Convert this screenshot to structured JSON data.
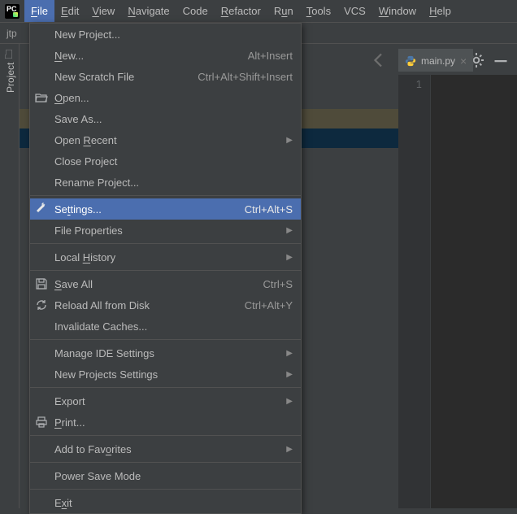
{
  "menubar": {
    "file": "File",
    "edit": "Edit",
    "view": "View",
    "navigate": "Navigate",
    "code": "Code",
    "refactor": "Refactor",
    "run": "Run",
    "tools": "Tools",
    "vcs": "VCS",
    "window": "Window",
    "help": "Help"
  },
  "breadcrumb": "jtp",
  "leftRail": {
    "project": "Project"
  },
  "editorTab": {
    "filename": "main.py",
    "lineNo": "1"
  },
  "fileMenu": {
    "newProject": "New Project...",
    "new": "New...",
    "newShortcut": "Alt+Insert",
    "newScratch": "New Scratch File",
    "newScratchShortcut": "Ctrl+Alt+Shift+Insert",
    "open": "Open...",
    "saveAs": "Save As...",
    "openRecent": "Open Recent",
    "closeProject": "Close Project",
    "renameProject": "Rename Project...",
    "settings": "Settings...",
    "settingsShortcut": "Ctrl+Alt+S",
    "fileProperties": "File Properties",
    "localHistory": "Local History",
    "saveAll": "Save All",
    "saveAllShortcut": "Ctrl+S",
    "reload": "Reload All from Disk",
    "reloadShortcut": "Ctrl+Alt+Y",
    "invalidate": "Invalidate Caches...",
    "manageIDE": "Manage IDE Settings",
    "newProjSettings": "New Projects Settings",
    "export": "Export",
    "print": "Print...",
    "addFav": "Add to Favorites",
    "powerSave": "Power Save Mode",
    "exit": "Exit"
  }
}
